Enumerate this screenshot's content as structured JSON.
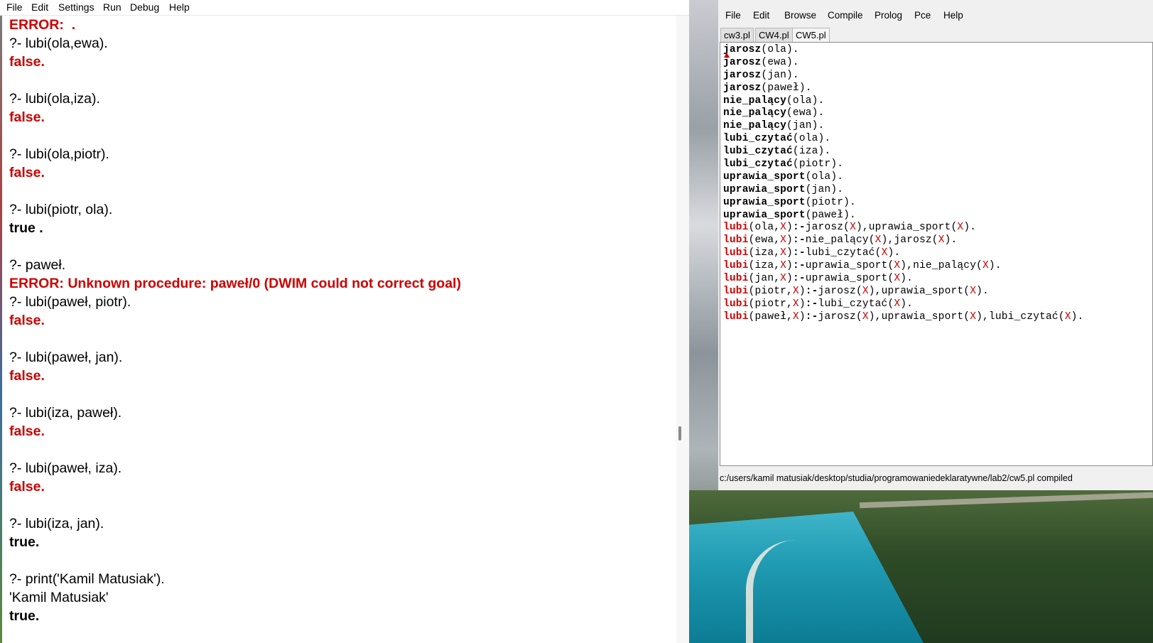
{
  "console": {
    "menu": [
      "File",
      "Edit",
      "Settings",
      "Run",
      "Debug",
      "Help"
    ],
    "lines": [
      {
        "text": "ERROR:  .",
        "style": "error"
      },
      {
        "text": "?- lubi(ola,ewa).",
        "style": "prompt"
      },
      {
        "text": "false.",
        "style": "false"
      },
      {
        "text": "",
        "style": "blank"
      },
      {
        "text": "?- lubi(ola,iza).",
        "style": "prompt"
      },
      {
        "text": "false.",
        "style": "false"
      },
      {
        "text": "",
        "style": "blank"
      },
      {
        "text": "?- lubi(ola,piotr).",
        "style": "prompt"
      },
      {
        "text": "false.",
        "style": "false"
      },
      {
        "text": "",
        "style": "blank"
      },
      {
        "text": "?- lubi(piotr, ola).",
        "style": "prompt"
      },
      {
        "text": "true .",
        "style": "true"
      },
      {
        "text": "",
        "style": "blank"
      },
      {
        "text": "?- paweł.",
        "style": "prompt"
      },
      {
        "text": "ERROR: Unknown procedure: paweł/0 (DWIM could not correct goal)",
        "style": "error"
      },
      {
        "text": "?- lubi(paweł, piotr).",
        "style": "prompt"
      },
      {
        "text": "false.",
        "style": "false"
      },
      {
        "text": "",
        "style": "blank"
      },
      {
        "text": "?- lubi(paweł, jan).",
        "style": "prompt"
      },
      {
        "text": "false.",
        "style": "false"
      },
      {
        "text": "",
        "style": "blank"
      },
      {
        "text": "?- lubi(iza, paweł).",
        "style": "prompt"
      },
      {
        "text": "false.",
        "style": "false"
      },
      {
        "text": "",
        "style": "blank"
      },
      {
        "text": "?- lubi(paweł, iza).",
        "style": "prompt"
      },
      {
        "text": "false.",
        "style": "false"
      },
      {
        "text": "",
        "style": "blank"
      },
      {
        "text": "?- lubi(iza, jan).",
        "style": "prompt"
      },
      {
        "text": "true.",
        "style": "true"
      },
      {
        "text": "",
        "style": "blank"
      },
      {
        "text": "?- print('Kamil Matusiak').",
        "style": "prompt"
      },
      {
        "text": "'Kamil Matusiak'",
        "style": "out"
      },
      {
        "text": "true.",
        "style": "true"
      }
    ]
  },
  "editor": {
    "menu": [
      "File",
      "Edit",
      "Browse",
      "Compile",
      "Prolog",
      "Pce",
      "Help"
    ],
    "tabs": [
      {
        "label": "cw3.pl",
        "active": false
      },
      {
        "label": "CW4.pl",
        "active": false
      },
      {
        "label": "CW5.pl",
        "active": true
      }
    ],
    "code_lines": [
      [
        [
          "head",
          "jarosz"
        ],
        [
          "arg",
          "(ola)."
        ]
      ],
      [
        [
          "head",
          "jarosz"
        ],
        [
          "arg",
          "(ewa)."
        ]
      ],
      [
        [
          "head",
          "jarosz"
        ],
        [
          "arg",
          "(jan)."
        ]
      ],
      [
        [
          "head",
          "jarosz"
        ],
        [
          "arg",
          "(paweł)."
        ]
      ],
      [
        [
          "head",
          "nie_palący"
        ],
        [
          "arg",
          "(ola)."
        ]
      ],
      [
        [
          "head",
          "nie_palący"
        ],
        [
          "arg",
          "(ewa)."
        ]
      ],
      [
        [
          "head",
          "nie_palący"
        ],
        [
          "arg",
          "(jan)."
        ]
      ],
      [
        [
          "head",
          "lubi_czytać"
        ],
        [
          "arg",
          "(ola)."
        ]
      ],
      [
        [
          "head",
          "lubi_czytać"
        ],
        [
          "arg",
          "(iza)."
        ]
      ],
      [
        [
          "head",
          "lubi_czytać"
        ],
        [
          "arg",
          "(piotr)."
        ]
      ],
      [
        [
          "head",
          "uprawia_sport"
        ],
        [
          "arg",
          "(ola)."
        ]
      ],
      [
        [
          "head",
          "uprawia_sport"
        ],
        [
          "arg",
          "(jan)."
        ]
      ],
      [
        [
          "head",
          "uprawia_sport"
        ],
        [
          "arg",
          "(piotr)."
        ]
      ],
      [
        [
          "head",
          "uprawia_sport"
        ],
        [
          "arg",
          "(paweł)."
        ]
      ],
      [
        [
          "rule",
          "lubi"
        ],
        [
          "arg",
          "(ola,"
        ],
        [
          "var",
          "X"
        ],
        [
          "arg",
          ")"
        ],
        [
          "neck",
          ":-"
        ],
        [
          "arg",
          "jarosz("
        ],
        [
          "var",
          "X"
        ],
        [
          "arg",
          "),uprawia_sport("
        ],
        [
          "var",
          "X"
        ],
        [
          "arg",
          ")."
        ]
      ],
      [
        [
          "rule",
          "lubi"
        ],
        [
          "arg",
          "(ewa,"
        ],
        [
          "var",
          "X"
        ],
        [
          "arg",
          ")"
        ],
        [
          "neck",
          ":-"
        ],
        [
          "arg",
          "nie_palący("
        ],
        [
          "var",
          "X"
        ],
        [
          "arg",
          "),jarosz("
        ],
        [
          "var",
          "X"
        ],
        [
          "arg",
          ")."
        ]
      ],
      [
        [
          "rule",
          "lubi"
        ],
        [
          "arg",
          "(iza,"
        ],
        [
          "var",
          "X"
        ],
        [
          "arg",
          ")"
        ],
        [
          "neck",
          ":-"
        ],
        [
          "arg",
          "lubi_czytać("
        ],
        [
          "var",
          "X"
        ],
        [
          "arg",
          ")."
        ]
      ],
      [
        [
          "rule",
          "lubi"
        ],
        [
          "arg",
          "(iza,"
        ],
        [
          "var",
          "X"
        ],
        [
          "arg",
          ")"
        ],
        [
          "neck",
          ":-"
        ],
        [
          "arg",
          "uprawia_sport("
        ],
        [
          "var",
          "X"
        ],
        [
          "arg",
          "),nie_palący("
        ],
        [
          "var",
          "X"
        ],
        [
          "arg",
          ")."
        ]
      ],
      [
        [
          "rule",
          "lubi"
        ],
        [
          "arg",
          "(jan,"
        ],
        [
          "var",
          "X"
        ],
        [
          "arg",
          ")"
        ],
        [
          "neck",
          ":-"
        ],
        [
          "arg",
          "uprawia_sport("
        ],
        [
          "var",
          "X"
        ],
        [
          "arg",
          ")."
        ]
      ],
      [
        [
          "rule",
          "lubi"
        ],
        [
          "arg",
          "(piotr,"
        ],
        [
          "var",
          "X"
        ],
        [
          "arg",
          ")"
        ],
        [
          "neck",
          ":-"
        ],
        [
          "arg",
          "jarosz("
        ],
        [
          "var",
          "X"
        ],
        [
          "arg",
          "),uprawia_sport("
        ],
        [
          "var",
          "X"
        ],
        [
          "arg",
          ")."
        ]
      ],
      [
        [
          "rule",
          "lubi"
        ],
        [
          "arg",
          "(piotr,"
        ],
        [
          "var",
          "X"
        ],
        [
          "arg",
          ")"
        ],
        [
          "neck",
          ":-"
        ],
        [
          "arg",
          "lubi_czytać("
        ],
        [
          "var",
          "X"
        ],
        [
          "arg",
          ")."
        ]
      ],
      [
        [
          "rule",
          "lubi"
        ],
        [
          "arg",
          "(paweł,"
        ],
        [
          "var",
          "X"
        ],
        [
          "arg",
          ")"
        ],
        [
          "neck",
          ":-"
        ],
        [
          "arg",
          "jarosz("
        ],
        [
          "var",
          "X"
        ],
        [
          "arg",
          "),uprawia_sport("
        ],
        [
          "var",
          "X"
        ],
        [
          "arg",
          "),lubi_czytać("
        ],
        [
          "var",
          "X"
        ],
        [
          "arg",
          ")."
        ]
      ]
    ],
    "status": "c:/users/kamil matusiak/desktop/studia/programowaniedeklaratywne/lab2/cw5.pl compiled"
  },
  "colors": {
    "error_red": "#cc0000",
    "menu_bg": "#f0f0f0"
  }
}
